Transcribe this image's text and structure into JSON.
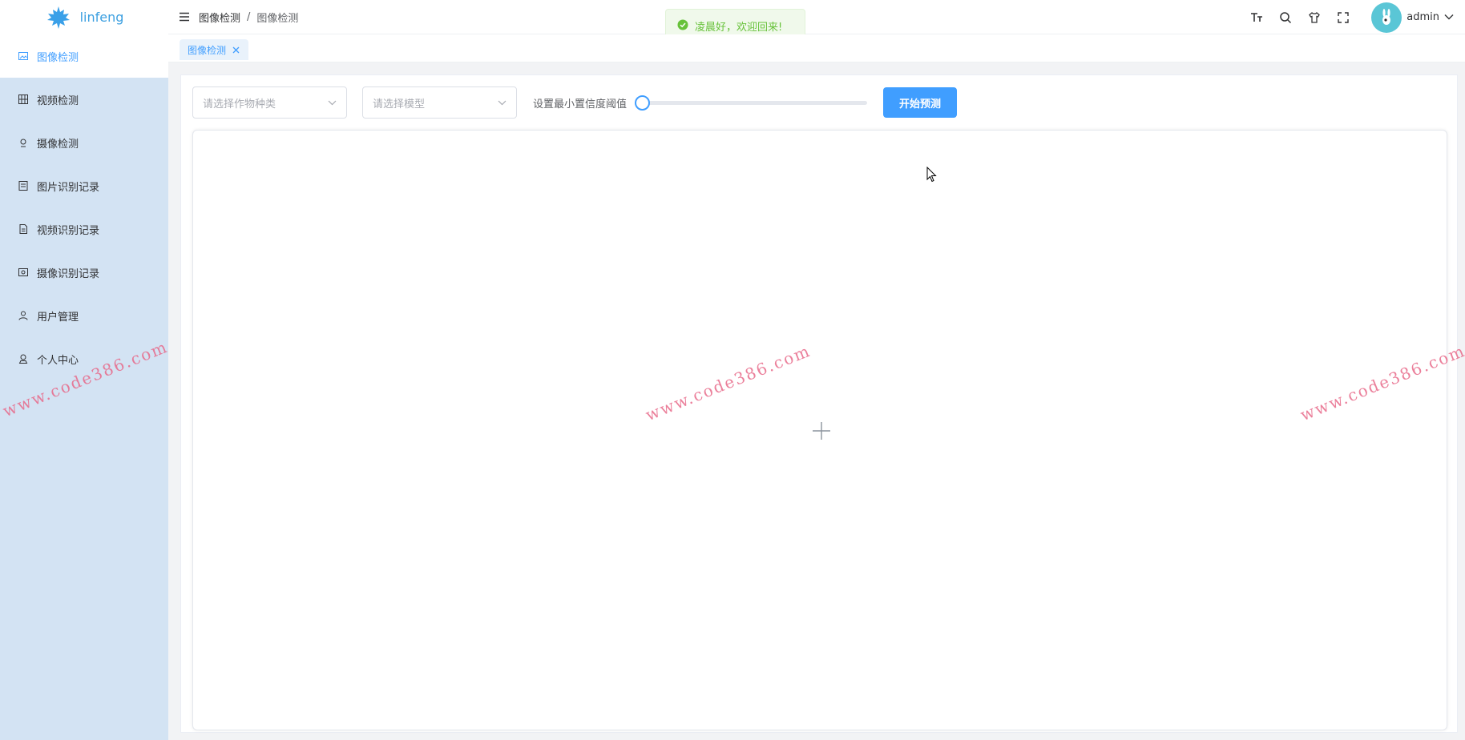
{
  "app": {
    "logo_text": "linfeng"
  },
  "sidebar": {
    "items": [
      {
        "label": "图像检测",
        "icon": "image-icon",
        "active": true
      },
      {
        "label": "视频检测",
        "icon": "video-icon",
        "active": false
      },
      {
        "label": "摄像检测",
        "icon": "camera-icon",
        "active": false
      },
      {
        "label": "图片识别记录",
        "icon": "image-record-icon",
        "active": false
      },
      {
        "label": "视频识别记录",
        "icon": "video-record-icon",
        "active": false
      },
      {
        "label": "摄像识别记录",
        "icon": "camera-record-icon",
        "active": false
      },
      {
        "label": "用户管理",
        "icon": "user-icon",
        "active": false
      },
      {
        "label": "个人中心",
        "icon": "profile-icon",
        "active": false
      }
    ]
  },
  "header": {
    "breadcrumb": [
      "图像检测",
      "图像检测"
    ],
    "breadcrumb_sep": "/",
    "username": "admin",
    "icons": [
      "font-size-icon",
      "search-icon",
      "theme-icon",
      "fullscreen-icon"
    ]
  },
  "toast": {
    "message": "凌晨好，欢迎回来!"
  },
  "tags": [
    {
      "label": "图像检测"
    }
  ],
  "toolbar": {
    "crop_select_placeholder": "请选择作物种类",
    "model_select_placeholder": "请选择模型",
    "slider_label": "设置最小置信度阈值",
    "slider_value": 0,
    "start_button": "开始预测"
  },
  "watermark": "www.code386.com",
  "colors": {
    "primary": "#409eff",
    "sidebar_bg": "#d3e3f3",
    "success": "#67c23a",
    "watermark": "#e86a8a"
  }
}
